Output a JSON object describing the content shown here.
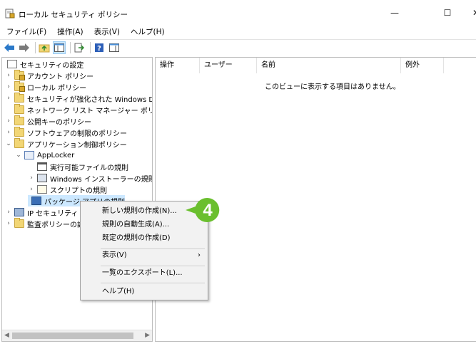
{
  "window": {
    "title": "ローカル セキュリティ ポリシー",
    "minimize": "—",
    "maximize": "☐",
    "close": "✕"
  },
  "menu": [
    "ファイル(F)",
    "操作(A)",
    "表示(V)",
    "ヘルプ(H)"
  ],
  "toolbar": {
    "icons": [
      "back-arrow-icon",
      "forward-arrow-icon",
      "up-folder-icon",
      "show-hide-tree-icon",
      "export-list-icon",
      "help-icon",
      "action-pane-icon"
    ]
  },
  "tree": {
    "root": "セキュリティの設定",
    "items": [
      "アカウント ポリシー",
      "ローカル ポリシー",
      "セキュリティが強化された Windows Defer",
      "ネットワーク リスト マネージャー ポリシー",
      "公開キーのポリシー",
      "ソフトウェアの制限のポリシー",
      "アプリケーション制御ポリシー",
      "AppLocker",
      "実行可能ファイルの規則",
      "Windows インストーラーの規則",
      "スクリプトの規則",
      "パッケージ アプリの規則",
      "IP セキュリティ ポリ",
      "監査ポリシーの詳"
    ]
  },
  "list": {
    "columns": [
      "操作",
      "ユーザー",
      "名前",
      "例外"
    ],
    "empty_message": "このビューに表示する項目はありません。"
  },
  "context_menu": {
    "items": [
      "新しい規則の作成(N)...",
      "規則の自動生成(A)...",
      "既定の規則の作成(D)",
      "表示(V)",
      "一覧のエクスポート(L)...",
      "ヘルプ(H)"
    ],
    "submenu_arrow": "›"
  },
  "badge": {
    "number": "4",
    "color": "#6abf2e"
  },
  "colors": {
    "selection": "#cce8ff",
    "folder": "#f2d675"
  }
}
